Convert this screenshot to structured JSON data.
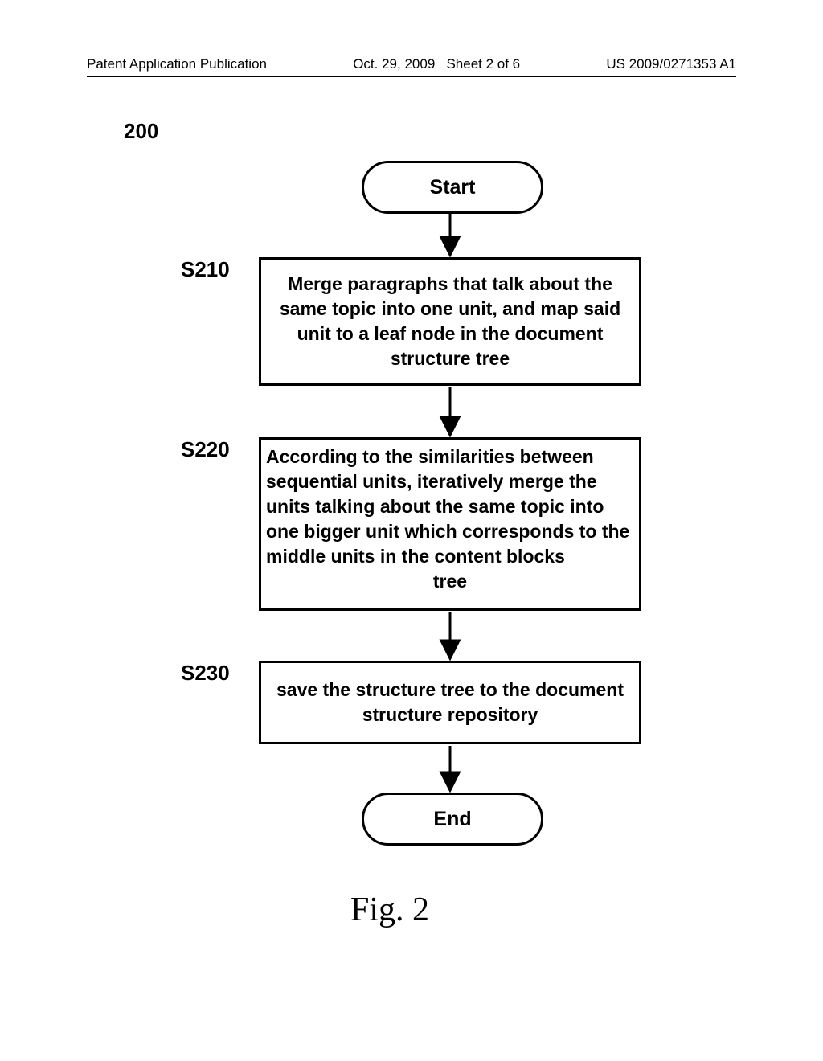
{
  "header": {
    "publication_label": "Patent Application Publication",
    "date": "Oct. 29, 2009",
    "sheet_info": "Sheet 2 of 6",
    "pub_number": "US 2009/0271353 A1"
  },
  "figure": {
    "reference_number": "200",
    "caption": "Fig. 2"
  },
  "steps": {
    "s210_label": "S210",
    "s220_label": "S220",
    "s230_label": "S230"
  },
  "nodes": {
    "start": "Start",
    "end": "End",
    "s210_text": "Merge paragraphs that talk about the same  topic into one unit, and map said unit to a  leaf node in the document structure tree",
    "s220_text_body": "According to the similarities between sequential units, iteratively merge the units talking about the same topic into one bigger  unit which corresponds to the middle units in the content blocks",
    "s220_text_last": "tree",
    "s230_text": "save the structure tree to the document structure repository"
  }
}
